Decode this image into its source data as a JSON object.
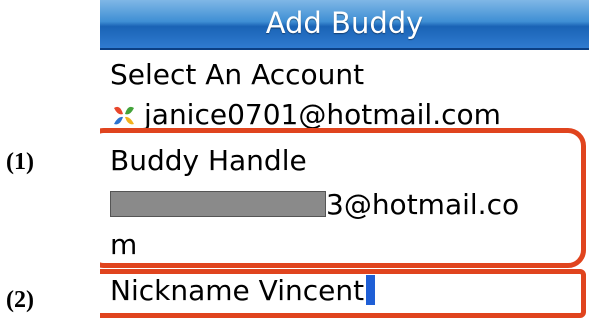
{
  "annotations": {
    "one": "(1)",
    "two": "(2)"
  },
  "titlebar": {
    "title": "Add Buddy"
  },
  "account": {
    "label": "Select An Account",
    "value": "janice0701@hotmail.com",
    "icon": "msn-butterfly-icon"
  },
  "buddy_handle": {
    "label": "Buddy Handle",
    "value_visible_part": "3@hotmail.co",
    "value_wrap": "m"
  },
  "nickname": {
    "label": "Nickname",
    "value": "Vincent"
  },
  "colors": {
    "highlight_box": "#e0441e",
    "titlebar": "#2f7bd0",
    "cursor": "#1f5fd6"
  }
}
